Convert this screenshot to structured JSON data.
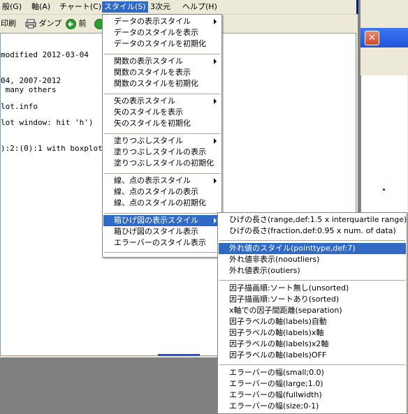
{
  "menubar": {
    "items": [
      {
        "label": "般(G)"
      },
      {
        "label": "軸(A)"
      },
      {
        "label": "チャート(C)"
      },
      {
        "label": "スタイル(S)"
      },
      {
        "label": "3次元"
      },
      {
        "label": "ヘルプ(H)"
      }
    ]
  },
  "toolbar": {
    "print_label": "印刷",
    "dump_label": "ダンプ",
    "back_label": "前"
  },
  "console": {
    "lines": [
      "modified 2012-03-04",
      "04, 2007-2012",
      " many others",
      "lot.info",
      "lot window: hit 'h')",
      "):2:(0):1 with boxplot"
    ]
  },
  "style_menu": {
    "items": [
      "データの表示スタイル",
      "データのスタイルを表示",
      "データのスタイルを初期化",
      "関数の表示スタイル",
      "関数のスタイルを表示",
      "関数のスタイルを初期化",
      "矢の表示スタイル",
      "矢のスタイルを表示",
      "矢のスタイルを初期化",
      "塗りつぶしスタイル",
      "塗りつぶしスタイルの表示",
      "塗りつぶしスタイルの初期化",
      "線、点の表示スタイル",
      "線、点のスタイルの表示",
      "線、点のスタイルの初期化",
      "箱ひげ図の表示スタイル",
      "箱ひげ図のスタイル表示",
      "エラーバーのスタイル表示"
    ]
  },
  "boxplot_submenu": {
    "items": [
      "ひげの長さ(range,def:1.5 x interquartile range)",
      "ひげの長さ(fraction,def:0.95 x num. of data)",
      "外れ値のスタイル(pointtype,def:7)",
      "外れ値非表示(nooutliers)",
      "外れ値表示(outiers)",
      "因子描画順:ソート無し(unsorted)",
      "因子描画順:ソートあり(sorted)",
      "x軸での因子間距離(separation)",
      "因子ラベルの軸(labels)自動",
      "因子ラベルの軸(labels)x軸",
      "因子ラベルの軸(labels)x2軸",
      "因子ラベルの軸(labels)OFF",
      "エラーバーの幅(small;0.0)",
      "エラーバーの幅(large;1.0)",
      "エラーバーの幅(fullwidth)",
      "エラーバーの幅(size;0-1)"
    ]
  },
  "colors": {
    "highlight": "#316ac5",
    "menu_bg": "#ffffff",
    "window_bg": "#ece9d8"
  },
  "icons": {
    "print": "printer-icon",
    "dump": "dump-printer-icon",
    "back": "back-arrow-icon",
    "forward": "forward-arrow-icon",
    "close": "close-icon",
    "submenu": "submenu-arrow-icon"
  }
}
